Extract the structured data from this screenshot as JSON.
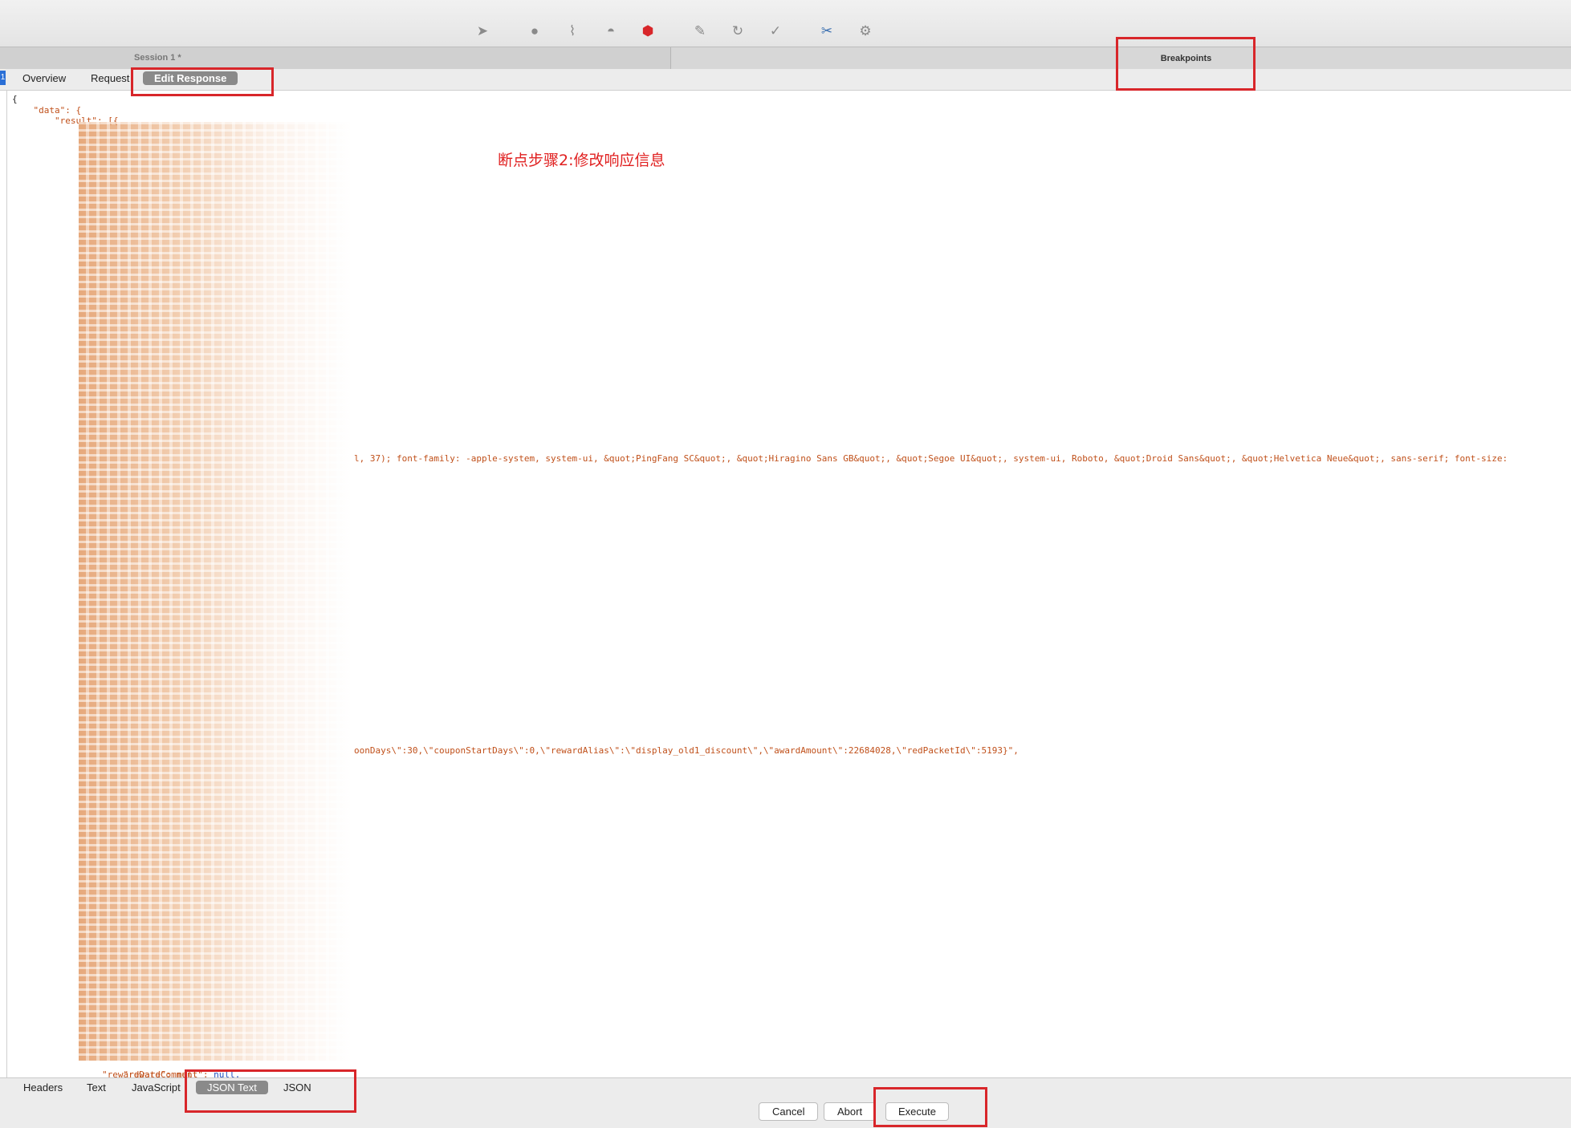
{
  "toolbar": {
    "tools": [
      {
        "icon": "pointer-icon",
        "glyph": "➤"
      },
      {
        "icon": "record-icon",
        "glyph": "●"
      },
      {
        "icon": "broom-icon",
        "glyph": "⌇"
      },
      {
        "icon": "turtle-icon",
        "glyph": "◓"
      },
      {
        "icon": "breakpoint-icon",
        "glyph": "⬢"
      },
      {
        "icon": "pen-icon",
        "glyph": "✎"
      },
      {
        "icon": "refresh-icon",
        "glyph": "↻"
      },
      {
        "icon": "check-icon",
        "glyph": "✓"
      },
      {
        "icon": "tools-icon",
        "glyph": "✂"
      },
      {
        "icon": "settings-icon",
        "glyph": "⚙"
      }
    ]
  },
  "tabs": {
    "session_title": "Session 1 *",
    "breakpoints_title": "Breakpoints"
  },
  "view_tabs": {
    "marker": "1",
    "overview": "Overview",
    "request": "Request",
    "edit_response": "Edit Response"
  },
  "editor": {
    "line1": "{",
    "line2": "    \"data\": {",
    "line3": "        \"result\": [{",
    "mid_line": "l, 37); font-family: -apple-system, system-ui, &quot;PingFang SC&quot;, &quot;Hiragino Sans GB&quot;, &quot;Segoe UI&quot;, system-ui, Roboto, &quot;Droid Sans&quot;, &quot;Helvetica Neue&quot;, sans-serif; font-size:",
    "coupon_line": "oonDays\\\":30,\\\"couponStartDays\\\":0,\\\"rewardAlias\\\":\\\"display_old1_discount\\\",\\\"awardAmount\\\":22684028,\\\"redPacketId\\\":5193}\",",
    "reward_key": "\"rewardComment\": ",
    "reward_value": "null,",
    "reward_date": "\"rewardDate\": null",
    "annotation": "断点步骤2:修改响应信息"
  },
  "bottom_tabs": {
    "headers": "Headers",
    "text": "Text",
    "javascript": "JavaScript",
    "json_text": "JSON Text",
    "json": "JSON"
  },
  "buttons": {
    "cancel": "Cancel",
    "abort": "Abort",
    "execute": "Execute"
  },
  "colors": {
    "highlight": "#d8262a",
    "json_key": "#c0501a",
    "annotation": "#e02020"
  }
}
